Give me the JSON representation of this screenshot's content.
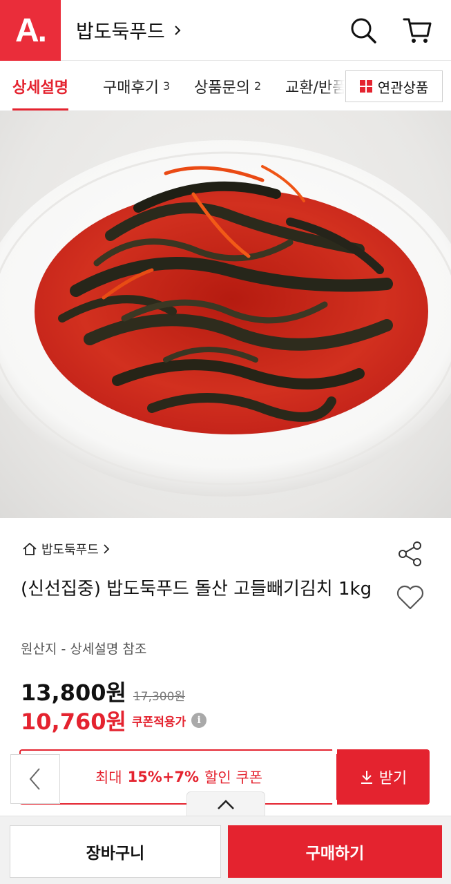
{
  "header": {
    "logo_text": "A.",
    "shop_name": "밥도둑푸드",
    "brand_color": "#ea2d3a"
  },
  "tabs": [
    {
      "label": "상세설명",
      "count": "",
      "active": true
    },
    {
      "label": "구매후기",
      "count": "3",
      "active": false
    },
    {
      "label": "상품문의",
      "count": "2",
      "active": false
    },
    {
      "label": "교환/반품",
      "count": "",
      "active": false
    }
  ],
  "related_button": {
    "label": "연관상품",
    "icon": "grid-icon"
  },
  "product": {
    "breadcrumb": "밥도둑푸드",
    "name": "(신선집중) 밥도둑푸드 돌산 고들빼기김치 1kg",
    "origin": "원산지 - 상세설명 참조",
    "price": "13,800원",
    "original_price": "17,300원",
    "coupon_price": "10,760원",
    "coupon_price_label": "쿠폰적용가",
    "info_icon": "i"
  },
  "coupon": {
    "prefix": "최대",
    "discount": "15%+7%",
    "suffix": "할인 쿠폰",
    "get_label": "받기"
  },
  "bottom": {
    "cart_label": "장바구니",
    "buy_label": "구매하기"
  },
  "colors": {
    "accent": "#e4232f",
    "sauce": "#c8251a"
  }
}
